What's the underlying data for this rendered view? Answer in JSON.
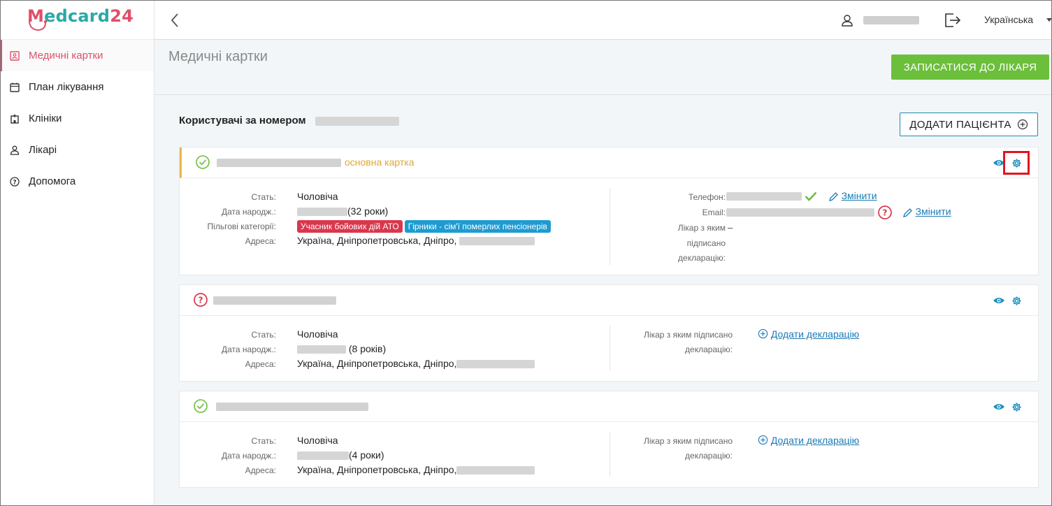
{
  "app": {
    "logo": {
      "part_a": "M",
      "part_b": "edcard",
      "part_c": "24"
    },
    "lang": "Українська"
  },
  "sidebar": {
    "items": [
      {
        "label": "Медичні картки",
        "icon": "id-card-icon",
        "active": true
      },
      {
        "label": "План лікування",
        "icon": "calendar-icon"
      },
      {
        "label": "Клініки",
        "icon": "hospital-icon"
      },
      {
        "label": "Лікарі",
        "icon": "doctor-icon"
      },
      {
        "label": "Допомога",
        "icon": "help-circle-icon"
      }
    ]
  },
  "page": {
    "title": "Медичні картки",
    "book_button": "ЗАПИСАТИСЯ ДО ЛІКАРЯ",
    "section_title": "Користувачі за номером",
    "add_patient_button": "ДОДАТИ ПАЦІЄНТА"
  },
  "labels": {
    "gender": "Стать:",
    "birth": "Дата народж.:",
    "benefits": "Пільгові категорії:",
    "address": "Адреса:",
    "phone": "Телефон:",
    "email": "Email:",
    "doctor_decl_1": "Лікар з яким",
    "doctor_decl_2": "підписано",
    "doctor_decl_3": "декларацію:",
    "doctor_signed_1": "Лікар з яким підписано",
    "doctor_signed_2": "декларацію:",
    "edit": "Змінити",
    "add_declaration": "Додати декларацію"
  },
  "cards": [
    {
      "status": "verified",
      "badge": "основна картка",
      "gender": "Чоловіча",
      "age": "(32 роки)",
      "benefits": [
        "Учасник бойових дій АТО",
        "Гірники - сім'ї померлих пенсіонерів"
      ],
      "address": "Україна, Дніпропетровська, Дніпро,",
      "doctor": "–"
    },
    {
      "status": "unverified",
      "gender": "Чоловіча",
      "age": "(8 років)",
      "address": "Україна, Дніпропетровська, Дніпро,"
    },
    {
      "status": "verified",
      "gender": "Чоловіча",
      "age": "(4 роки)",
      "address": "Україна, Дніпропетровська, Дніпро,"
    }
  ],
  "colors": {
    "brand_pink": "#e04f6a",
    "brand_teal": "#2aa9a7",
    "primary_green": "#6bbf3b",
    "link_blue": "#1a7bb5",
    "badge_gold": "#e0a830",
    "highlight_red": "#e4141e"
  }
}
